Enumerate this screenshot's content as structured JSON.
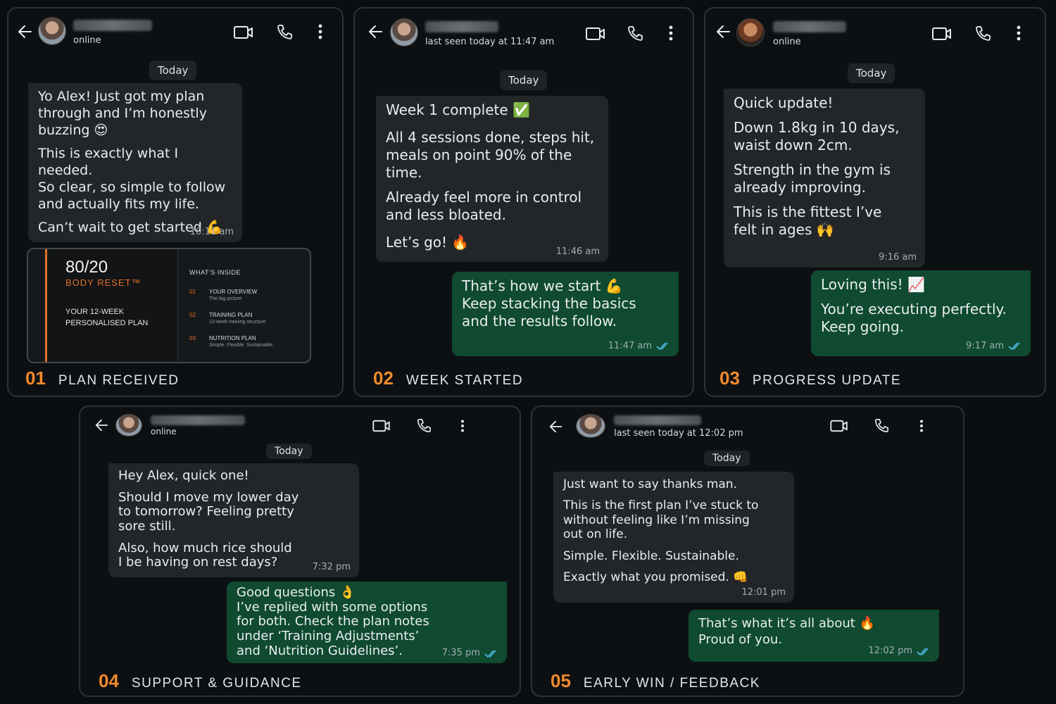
{
  "colors": {
    "accent": "#f08a2c",
    "incoming": "#232629",
    "outgoing": "#0f4a31",
    "read_ticks": "#53bdeb"
  },
  "icons": [
    "back-arrow-icon",
    "video-call-icon",
    "phone-icon",
    "more-options-icon",
    "double-check-icon"
  ],
  "panels": [
    {
      "status": "online",
      "day": "Today",
      "caption": {
        "num": "01",
        "label": "PLAN RECEIVED"
      },
      "messages": [
        {
          "dir": "in",
          "paragraphs": [
            "Yo Alex! Just got my plan\nthrough and I’m honestly\nbuzzing 😍",
            "This is exactly what I needed.\nSo clear, so simple to follow\nand actually fits my life.",
            "Can’t wait to get started 💪"
          ],
          "time": "10:11 am"
        }
      ],
      "document": {
        "title": "80/20",
        "brand": "BODY RESET™",
        "subtitle": "YOUR 12-WEEK\nPERSONALISED PLAN",
        "inside_label": "WHAT’S INSIDE",
        "items": [
          {
            "num": "01",
            "title": "YOUR OVERVIEW",
            "desc": "The big picture"
          },
          {
            "num": "02",
            "title": "TRAINING PLAN",
            "desc": "12-week training structure"
          },
          {
            "num": "03",
            "title": "NUTRITION PLAN",
            "desc": "Simple. Flexible. Sustainable."
          }
        ]
      }
    },
    {
      "status": "last seen today at 11:47 am",
      "day": "Today",
      "caption": {
        "num": "02",
        "label": "WEEK STARTED"
      },
      "messages": [
        {
          "dir": "in",
          "paragraphs": [
            "Week 1 complete ✅",
            "All 4 sessions done, steps hit,\nmeals on point 90% of the time.",
            "Already feel more in control\nand less bloated.",
            "Let’s go! 🔥"
          ],
          "time": "11:46 am"
        },
        {
          "dir": "out",
          "paragraphs": [
            "That’s how we start 💪\nKeep stacking the basics\nand the results follow."
          ],
          "time": "11:47 am"
        }
      ]
    },
    {
      "status": "online",
      "day": "Today",
      "caption": {
        "num": "03",
        "label": "PROGRESS UPDATE"
      },
      "messages": [
        {
          "dir": "in",
          "paragraphs": [
            "Quick update!",
            "Down 1.8kg in 10 days,\nwaist down 2cm.",
            "Strength in the gym is\nalready improving.",
            "This is the fittest I’ve\nfelt in ages 🙌"
          ],
          "time": "9:16 am"
        },
        {
          "dir": "out",
          "paragraphs": [
            "Loving this! 📈",
            "You’re executing perfectly.\nKeep going."
          ],
          "time": "9:17 am"
        }
      ]
    },
    {
      "status": "online",
      "day": "Today",
      "caption": {
        "num": "04",
        "label": "SUPPORT & GUIDANCE"
      },
      "messages": [
        {
          "dir": "in",
          "paragraphs": [
            "Hey Alex, quick one!",
            "Should I move my lower day\nto tomorrow? Feeling pretty\nsore still.",
            "Also, how much rice should\nI be having on rest days?"
          ],
          "time": "7:32 pm"
        },
        {
          "dir": "out",
          "paragraphs": [
            "Good questions 👌\nI’ve replied with some options\nfor both. Check the plan notes\nunder ‘Training Adjustments’\nand ‘Nutrition Guidelines’."
          ],
          "time": "7:35 pm"
        }
      ]
    },
    {
      "status": "last seen today at 12:02 pm",
      "day": "Today",
      "caption": {
        "num": "05",
        "label": "EARLY WIN / FEEDBACK"
      },
      "messages": [
        {
          "dir": "in",
          "paragraphs": [
            "Just want to say thanks man.",
            "This is the first plan I’ve stuck to\nwithout feeling like I’m missing\nout on life.",
            "Simple. Flexible. Sustainable.",
            "Exactly what you promised. 👊"
          ],
          "time": "12:01 pm"
        },
        {
          "dir": "out",
          "paragraphs": [
            "That’s what it’s all about 🔥\nProud of you."
          ],
          "time": "12:02 pm"
        }
      ]
    }
  ]
}
